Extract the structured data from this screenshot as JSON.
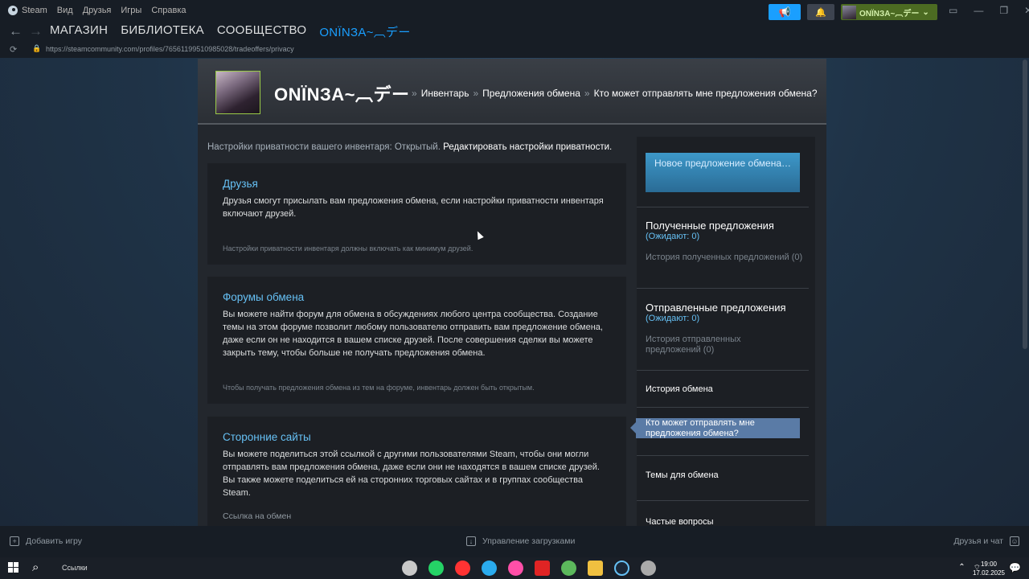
{
  "menubar": {
    "brand": "Steam",
    "items": [
      "Вид",
      "Друзья",
      "Игры",
      "Справка"
    ]
  },
  "topbar": {
    "username": "ONÏNЗA~︹デー"
  },
  "nav": {
    "tabs": [
      "МАГАЗИН",
      "БИБЛИОТЕКА",
      "СООБЩЕСТВО",
      "ONÏNЗA~︹デー"
    ],
    "active_index": 3
  },
  "urlbar": {
    "url": "https://steamcommunity.com/profiles/76561199510985028/tradeoffers/privacy"
  },
  "profile": {
    "name": "ONÏNЗA~︹デー",
    "breadcrumb": [
      "Инвентарь",
      "Предложения обмена",
      "Кто может отправлять мне предложения обмена?"
    ],
    "separator": "»"
  },
  "privacy": {
    "text": "Настройки приватности вашего инвентаря: Открытый.",
    "edit_link": "Редактировать настройки приватности."
  },
  "cards": [
    {
      "title": "Друзья",
      "body": "Друзья смогут присылать вам предложения обмена, если настройки приватности инвентаря включают друзей.",
      "note": "Настройки приватности инвентаря должны включать как минимум друзей."
    },
    {
      "title": "Форумы обмена",
      "body": "Вы можете найти форум для обмена в обсуждениях любого центра сообщества. Создание темы на этом форуме позволит любому пользователю отправить вам предложение обмена, даже если он не находится в вашем списке друзей. После совершения сделки вы можете закрыть тему, чтобы больше не получать предложения обмена.",
      "note": "Чтобы получать предложения обмена из тем на форуме, инвентарь должен быть открытым."
    },
    {
      "title": "Сторонние сайты",
      "body": "Вы можете поделиться этой ссылкой с другими пользователями Steam, чтобы они могли отправлять вам предложения обмена, даже если они не находятся в вашем списке друзей. Вы также можете поделиться ей на сторонних торговых сайтах и в группах сообщества Steam.",
      "note": "Ссылка на обмен"
    }
  ],
  "sidebar": {
    "new_offer": "Новое предложение обмена…",
    "received": {
      "title": "Полученные предложения",
      "waiting": "(Ожидают: 0)",
      "history": "История полученных предложений (0)"
    },
    "sent": {
      "title": "Отправленные предложения",
      "waiting": "(Ожидают: 0)",
      "history": "История отправленных предложений (0)"
    },
    "links": [
      "История обмена",
      "Кто может отправлять мне предложения обмена?",
      "Темы для обмена",
      "Частые вопросы"
    ],
    "active_index": 1
  },
  "bottombar": {
    "add_game": "Добавить игру",
    "downloads": "Управление загрузками",
    "friends": "Друзья и чат"
  },
  "taskbar": {
    "links_label": "Ссылки",
    "time": "19:00",
    "date": "17.02.2025"
  },
  "colors": {
    "accent": "#1a9fff",
    "link": "#66c0f4",
    "online_green": "#4c6b22",
    "active_sidebar": "#5a7ba6"
  }
}
